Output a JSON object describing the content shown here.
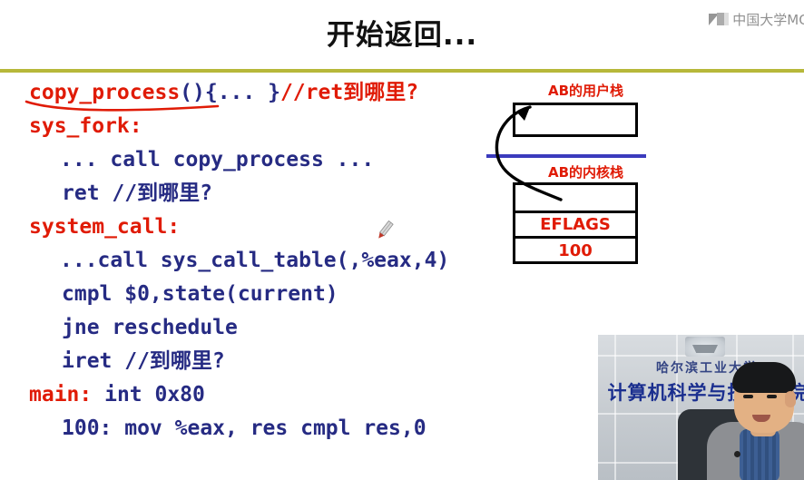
{
  "slide": {
    "title": "开始返回...",
    "watermark": {
      "text": "中国大学MO",
      "icon": "mooc-logo-icon"
    }
  },
  "code": {
    "lines": [
      {
        "id": "line-copy-process",
        "segments": [
          {
            "text": "copy_process",
            "color": "red"
          },
          {
            "text": "(){... }",
            "color": "navy"
          },
          {
            "text": "//ret到哪里?",
            "color": "red"
          }
        ]
      },
      {
        "id": "line-sys-fork",
        "segments": [
          {
            "text": "sys_fork:",
            "color": "red"
          }
        ]
      },
      {
        "id": "line-call-copy-process",
        "indent": 1,
        "segments": [
          {
            "text": "... call copy_process ...",
            "color": "navy"
          }
        ]
      },
      {
        "id": "line-ret",
        "indent": 2,
        "segments": [
          {
            "text": "ret //到哪里?",
            "color": "navy"
          }
        ]
      },
      {
        "id": "line-system-call",
        "segments": [
          {
            "text": "system_call:",
            "color": "red"
          }
        ]
      },
      {
        "id": "line-call-sys-call-table",
        "indent": 1,
        "segments": [
          {
            "text": "...call sys_call_table(,%eax,4)",
            "color": "navy"
          }
        ]
      },
      {
        "id": "line-cmpl-state",
        "indent": 2,
        "segments": [
          {
            "text": "cmpl $0,state(current)",
            "color": "navy"
          }
        ]
      },
      {
        "id": "line-jne-reschedule",
        "indent": 2,
        "segments": [
          {
            "text": "jne reschedule",
            "color": "navy"
          }
        ]
      },
      {
        "id": "line-iret",
        "indent": 2,
        "segments": [
          {
            "text": "iret //到哪里?",
            "color": "navy"
          }
        ]
      },
      {
        "id": "line-main",
        "segments": [
          {
            "text": "main:",
            "color": "red"
          },
          {
            "text": " int 0x80",
            "color": "navy"
          }
        ]
      },
      {
        "id": "line-100-mov",
        "indent": 2,
        "segments": [
          {
            "text": "100: mov %eax, res cmpl res,0",
            "color": "navy"
          }
        ]
      }
    ]
  },
  "diagram": {
    "user_stack_label": "AB的用户栈",
    "kernel_stack_label": "AB的内核栈",
    "kernel_cells": [
      "",
      "EFLAGS",
      "100"
    ],
    "arrow": "curved-return-arrow",
    "separator": "user-kernel-boundary-line"
  },
  "video": {
    "sign_top": "哈尔滨工业大学",
    "sign_main": "计算机科学与技术学院"
  },
  "colors": {
    "red": "#e01b06",
    "navy": "#262b83",
    "divider": "#b7b83a",
    "boundary": "#3b3bbd"
  }
}
